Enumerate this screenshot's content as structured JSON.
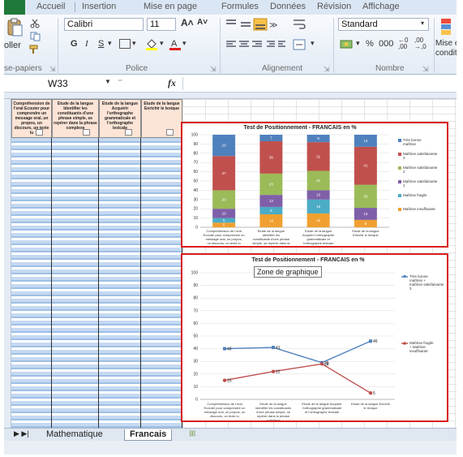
{
  "ribbon": {
    "tabs": [
      "Accueil",
      "Insertion",
      "Mise en page",
      "Formules",
      "Données",
      "Révision",
      "Affichage"
    ],
    "clipboard": {
      "paste_label": "oller",
      "group_label": "se-papiers"
    },
    "font": {
      "name": "Calibri",
      "size": "11",
      "group_label": "Police",
      "bold": "G",
      "italic": "I",
      "underline": "S"
    },
    "alignment": {
      "group_label": "Alignement"
    },
    "number": {
      "format": "Standard",
      "percent": "%",
      "thousands": "000",
      "group_label": "Nombre"
    },
    "styles": {
      "conditional_label": "Mise e",
      "conditional_label2": "conditi"
    }
  },
  "formula_bar": {
    "name_box": "W33",
    "fx": "fx",
    "content": ""
  },
  "sheet": {
    "headers": [
      "Compréhension de l'oral Ecouter pour comprendre un message oral, un propos, un discours, un texte lu",
      "Etude de la langue Identifier les constituants d'une phrase simple, se repérer dans la phrase complexe",
      "Etude de la langue Acquérir l'orthographe grammaticale et l'orthographe lexicale",
      "Etude de la langue Enrichir le lexique"
    ]
  },
  "chart1": {
    "tooltip": ""
  },
  "chart2": {
    "tooltip": "Zone de graphique"
  },
  "chart_data": [
    {
      "type": "bar",
      "stacked": true,
      "title": "Test de Positionnement - FRANCAIS en %",
      "ylim": [
        0,
        100
      ],
      "yticks": [
        0,
        10,
        20,
        30,
        40,
        50,
        60,
        70,
        80,
        90,
        100
      ],
      "categories": [
        "Compréhension de l'oral Ecouter pour comprendre un message oral, un propos, un discours, un texte lu",
        "Etude de la langue Identifier les constituants d'une phrase simple, se repérer dans la phrase complexe",
        "Etude de la langue Acquérir l'orthographe grammaticale et l'orthographe lexicale",
        "Etude de la langue Enrichir le lexique"
      ],
      "series": [
        {
          "name": "Maîtrise insuffisante",
          "color": "#f0a030",
          "values": [
            5,
            14,
            15,
            8
          ]
        },
        {
          "name": "Maîtrise fragile",
          "color": "#4bacc6",
          "values": [
            5,
            8,
            15,
            0
          ]
        },
        {
          "name": "Maîtrise satisfaisante 1",
          "color": "#7f5fa8",
          "values": [
            10,
            13,
            10,
            13
          ]
        },
        {
          "name": "Maîtrise satisfaisante 2",
          "color": "#9bbb59",
          "values": [
            20,
            23,
            21,
            25
          ]
        },
        {
          "name": "Maîtrise satisfaisante 3",
          "color": "#c0504d",
          "values": [
            37,
            35,
            31,
            41
          ]
        },
        {
          "name": "Très bonne maîtrise",
          "color": "#4f81bd",
          "values": [
            23,
            7,
            8,
            13
          ]
        }
      ],
      "segment_labels": [
        [
          "5",
          "5",
          "10",
          "20",
          "37",
          "23"
        ],
        [
          "14",
          "8",
          "13",
          "23",
          "35",
          "7"
        ],
        [
          "15",
          "15",
          "10",
          "21",
          "31",
          "8"
        ],
        [
          "8",
          "",
          "13",
          "25",
          "41",
          "13"
        ]
      ],
      "legend": "right",
      "grid": true
    },
    {
      "type": "line",
      "title": "Test de Positionnement - FRANCAIS en %",
      "ylim": [
        0,
        100
      ],
      "yticks": [
        0,
        10,
        20,
        30,
        40,
        50,
        60,
        70,
        80,
        90,
        100
      ],
      "categories": [
        "Compréhension de l'oral Ecouter pour comprendre un message oral, un propos, un discours, un texte lu",
        "Etude de la langue Identifier les constituants d'une phrase simple, se repérer dans la phrase complexe",
        "Etude de la langue Acquérir l'orthographe grammaticale et l'orthographe lexicale",
        "Etude de la langue Enrichir le lexique"
      ],
      "series": [
        {
          "name": "Très bonne maîtrise + maîtrise satisfaisante 3",
          "color": "#4f81bd",
          "values": [
            40,
            41,
            29,
            46
          ],
          "labels": [
            "40",
            "41",
            "29",
            "46"
          ]
        },
        {
          "name": "Maîtrise fragile + Maîtrise insuffisante",
          "color": "#c0504d",
          "values": [
            15,
            22,
            28,
            5
          ],
          "labels": [
            "15",
            "22",
            "28",
            "5"
          ]
        }
      ],
      "legend": "right",
      "grid": true
    }
  ],
  "sheet_tabs": {
    "tabs": [
      "Mathematique",
      "Francais"
    ],
    "active": "Francais"
  },
  "colors": {
    "chart_border": "#d91e1e",
    "header_fill": "#fce4d6",
    "cell_fill": "#c5d9f1",
    "file_tab": "#1f7a3a"
  }
}
